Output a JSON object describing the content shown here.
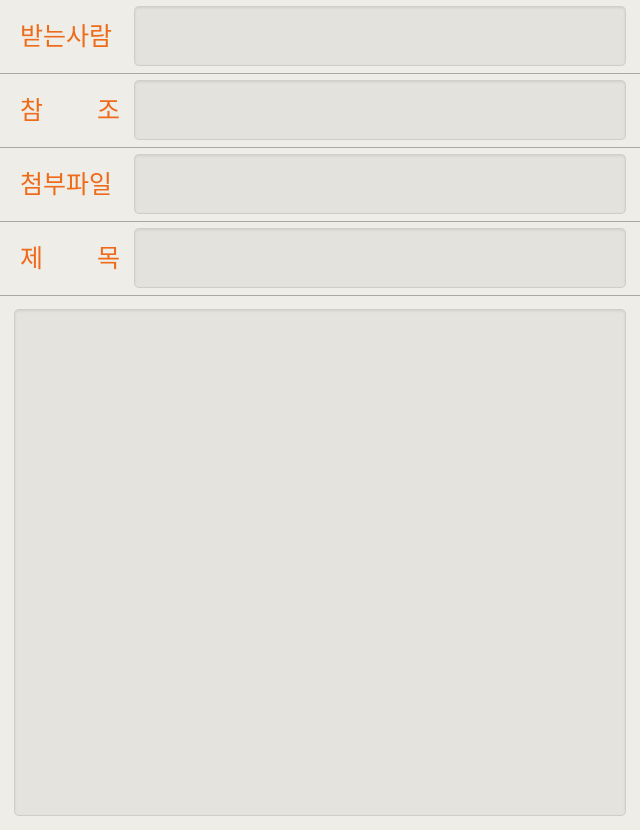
{
  "compose": {
    "to": {
      "label": "받는사람",
      "value": ""
    },
    "cc": {
      "label_left": "참",
      "label_right": "조",
      "value": ""
    },
    "attachment": {
      "label": "첨부파일",
      "value": ""
    },
    "subject": {
      "label_left": "제",
      "label_right": "목",
      "value": ""
    },
    "body": {
      "value": ""
    }
  },
  "colors": {
    "label": "#ef6b1a",
    "background": "#eeede8",
    "field_fill": "#e3e2dc",
    "divider": "#a9a8a3"
  }
}
